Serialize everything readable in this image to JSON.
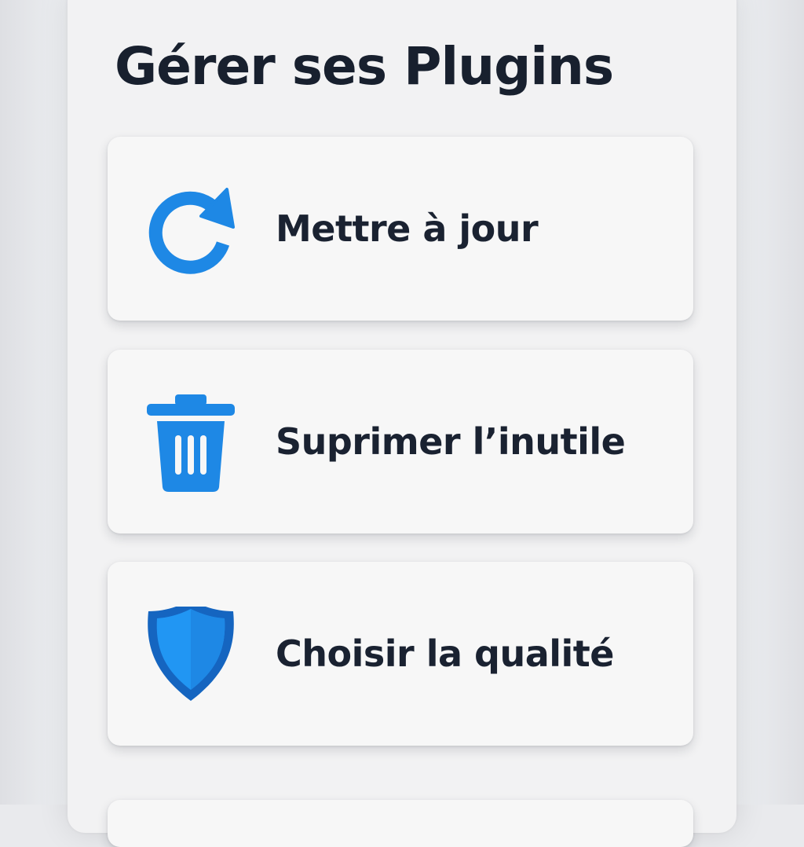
{
  "page": {
    "title": "Gérer ses Plugins"
  },
  "actions": [
    {
      "label": "Mettre à jour",
      "icon": "refresh-icon"
    },
    {
      "label": "Suprimer l’inutile",
      "icon": "trash-icon"
    },
    {
      "label": "Choisir la qualité",
      "icon": "shield-icon"
    }
  ],
  "colors": {
    "accent": "#1e88e5",
    "accent_dark": "#1565c0",
    "title_text": "#18202e",
    "card_background": "#f7f7f7",
    "panel_background": "#f2f2f3"
  }
}
